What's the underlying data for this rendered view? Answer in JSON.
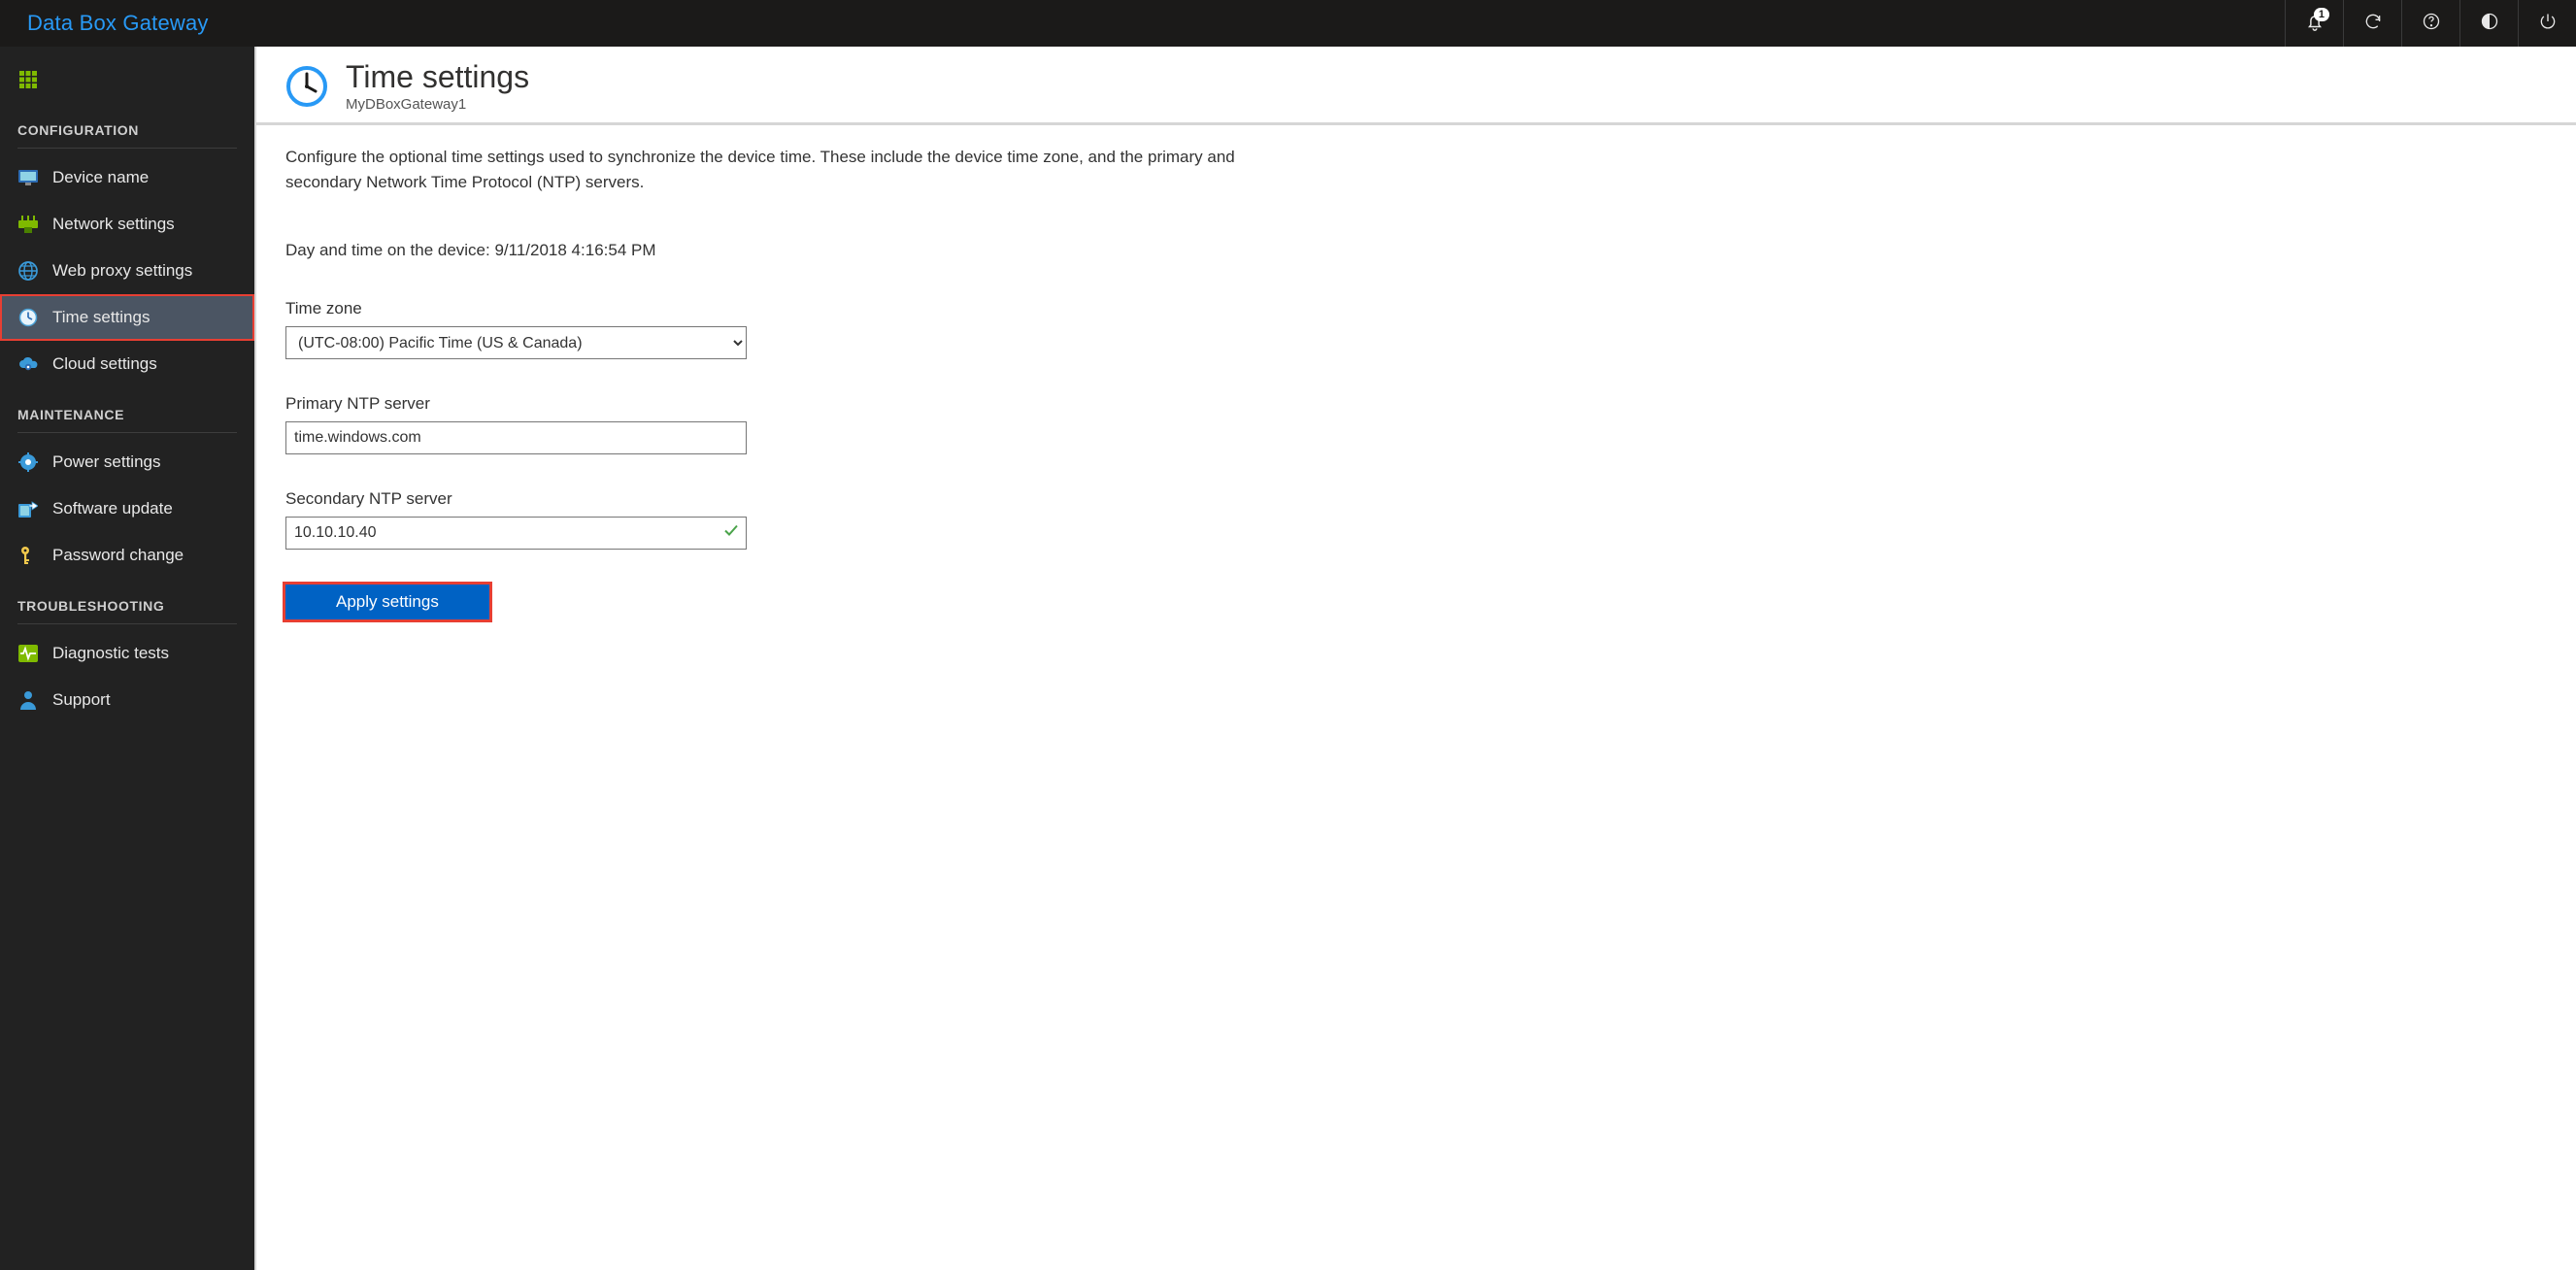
{
  "topbar": {
    "brand": "Data Box Gateway",
    "notifications_count": "1"
  },
  "sidebar": {
    "dashboard": "Dashboard",
    "sections": {
      "configuration": "CONFIGURATION",
      "maintenance": "MAINTENANCE",
      "troubleshooting": "TROUBLESHOOTING"
    },
    "items": {
      "device_name": "Device name",
      "network_settings": "Network settings",
      "web_proxy": "Web proxy settings",
      "time_settings": "Time settings",
      "cloud_settings": "Cloud settings",
      "power_settings": "Power settings",
      "software_update": "Software update",
      "password_change": "Password change",
      "diagnostic_tests": "Diagnostic tests",
      "support": "Support"
    }
  },
  "page": {
    "title": "Time settings",
    "subtitle": "MyDBoxGateway1",
    "intro": "Configure the optional time settings used to synchronize the device time. These include the device time zone, and the primary and secondary Network Time Protocol (NTP) servers.",
    "device_time_label": "Day and time on the device: ",
    "device_time_value": "9/11/2018 4:16:54 PM",
    "timezone_label": "Time zone",
    "timezone_value": "(UTC-08:00) Pacific Time (US & Canada)",
    "primary_ntp_label": "Primary NTP server",
    "primary_ntp_value": "time.windows.com",
    "secondary_ntp_label": "Secondary NTP server",
    "secondary_ntp_value": "10.10.10.40",
    "apply_button": "Apply settings"
  }
}
